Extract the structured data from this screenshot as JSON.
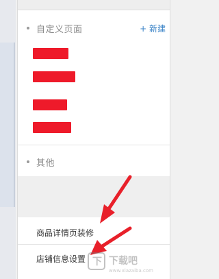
{
  "sections": {
    "custom_pages": {
      "title": "自定义页面",
      "new_label": "+ 新建"
    },
    "other": {
      "title": "其他"
    }
  },
  "custom_items_count": 4,
  "menu": {
    "items": [
      {
        "label": "商品详情页装修"
      },
      {
        "label": "店铺信息设置"
      }
    ]
  },
  "watermark": {
    "brand": "下载吧",
    "sub": "www.xiazaiba.com"
  },
  "colors": {
    "accent": "#3a83c7",
    "redaction": "#ee1a2a",
    "arrow": "#e8202a"
  }
}
